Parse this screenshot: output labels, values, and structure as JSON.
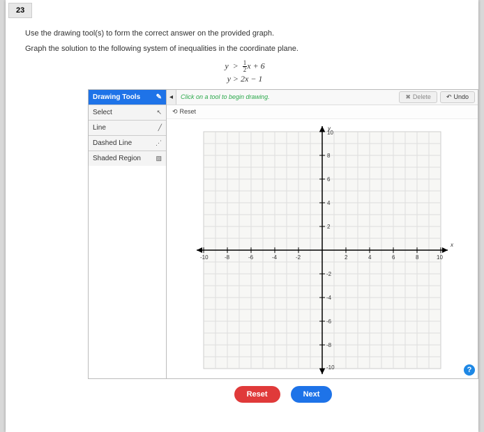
{
  "question_number": "23",
  "instruction1": "Use the drawing tool(s) to form the correct answer on the provided graph.",
  "instruction2": "Graph the solution to the following system of inequalities in the coordinate plane.",
  "equations": {
    "line1_var": "y",
    "line1_op": ">",
    "line1_frac_n": "1",
    "line1_frac_d": "2",
    "line1_rest": "x + 6",
    "line2": "y  >  2x − 1"
  },
  "tools": {
    "header": "Drawing Tools",
    "items": [
      {
        "label": "Select",
        "icon": "↖"
      },
      {
        "label": "Line",
        "icon": "╱"
      },
      {
        "label": "Dashed Line",
        "icon": "⋰"
      },
      {
        "label": "Shaded Region",
        "icon": "▨"
      }
    ]
  },
  "canvas": {
    "tip": "Click on a tool to begin drawing.",
    "delete_label": "Delete",
    "undo_label": "Undo",
    "reset_tool": "Reset"
  },
  "axes": {
    "x_label": "x",
    "y_label": "y",
    "ticks": [
      "-10",
      "-8",
      "-6",
      "-4",
      "-2",
      "2",
      "4",
      "6",
      "8",
      "10"
    ]
  },
  "buttons": {
    "reset": "Reset",
    "next": "Next"
  },
  "help": "?"
}
